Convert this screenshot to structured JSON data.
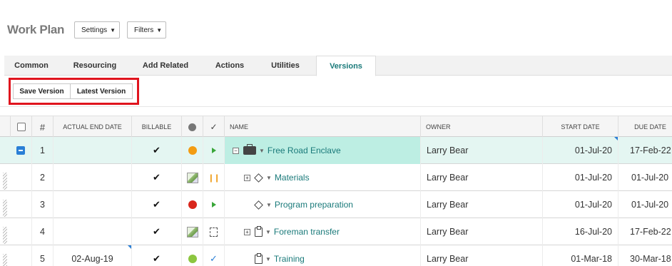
{
  "header": {
    "title": "Work Plan",
    "settings_label": "Settings",
    "filters_label": "Filters"
  },
  "tabs": [
    {
      "label": "Common",
      "active": false
    },
    {
      "label": "Resourcing",
      "active": false
    },
    {
      "label": "Add Related",
      "active": false
    },
    {
      "label": "Actions",
      "active": false
    },
    {
      "label": "Utilities",
      "active": false
    },
    {
      "label": "Versions",
      "active": true
    }
  ],
  "toolbar": {
    "save_version_label": "Save Version",
    "latest_version_label": "Latest Version",
    "highlight_color": "#e0141e"
  },
  "grid": {
    "columns": {
      "number": "#",
      "actual_end_date": "ACTUAL END DATE",
      "billable": "BILLABLE",
      "name": "NAME",
      "owner": "OWNER",
      "start_date": "START DATE",
      "due_date": "DUE DATE"
    },
    "rows": [
      {
        "num": "1",
        "actual_end": "",
        "billable": "✔",
        "status_color": "#f39c12",
        "state": "play",
        "name": "Free Road Enclave",
        "icon": "briefcase-icon",
        "owner": "Larry Bear",
        "start": "01-Jul-20",
        "due": "17-Feb-22",
        "selected": true
      },
      {
        "num": "2",
        "actual_end": "",
        "billable": "✔",
        "status_color": "",
        "state": "pause",
        "name": "Materials",
        "icon": "milestone-diamond-icon",
        "owner": "Larry Bear",
        "start": "01-Jul-20",
        "due": "01-Jul-20",
        "selected": false
      },
      {
        "num": "3",
        "actual_end": "",
        "billable": "✔",
        "status_color": "#d9261c",
        "state": "play",
        "name": "Program preparation",
        "icon": "milestone-diamond-icon",
        "owner": "Larry Bear",
        "start": "01-Jul-20",
        "due": "01-Jul-20",
        "selected": false
      },
      {
        "num": "4",
        "actual_end": "",
        "billable": "✔",
        "status_color": "",
        "state": "draft",
        "name": "Foreman transfer",
        "icon": "clipboard-task-icon",
        "owner": "Larry Bear",
        "start": "16-Jul-20",
        "due": "17-Feb-22",
        "selected": false
      },
      {
        "num": "5",
        "actual_end": "02-Aug-19",
        "billable": "✔",
        "status_color": "#8cc63f",
        "state": "done",
        "name": "Training",
        "icon": "clipboard-task-icon",
        "owner": "Larry Bear",
        "start": "01-Mar-18",
        "due": "30-Mar-18",
        "selected": false
      }
    ]
  }
}
